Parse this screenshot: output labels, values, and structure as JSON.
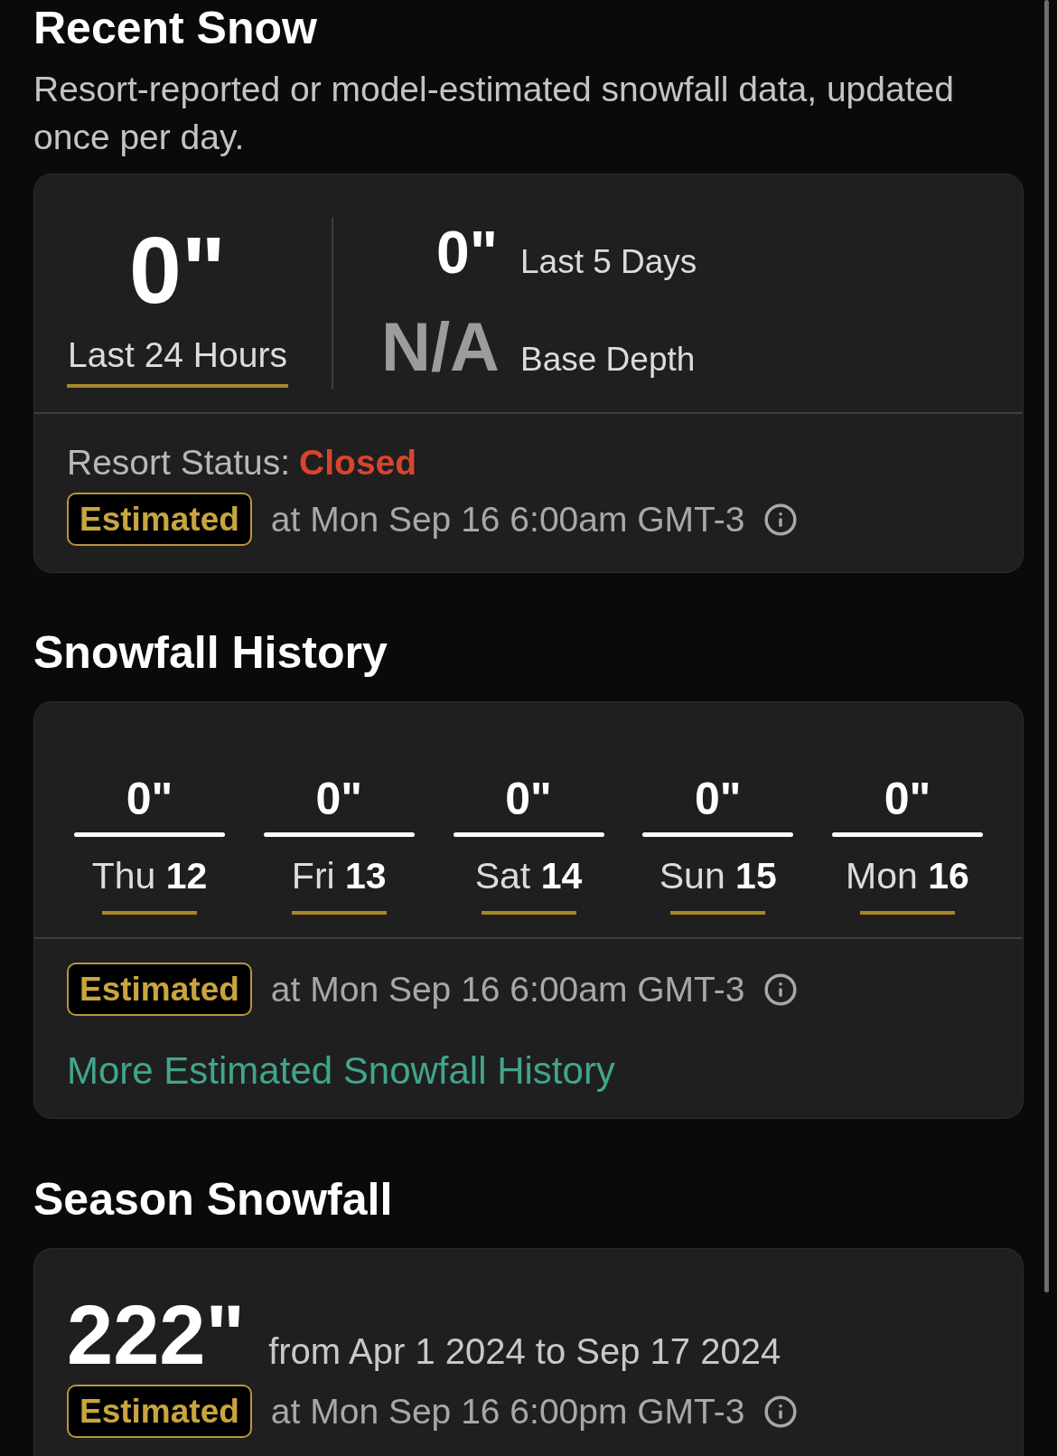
{
  "recent_snow": {
    "title": "Recent Snow",
    "subtitle": "Resort-reported or model-estimated snowfall data, updated once per day.",
    "last_24h": {
      "value": "0\"",
      "label": "Last 24 Hours"
    },
    "stats": [
      {
        "value": "0\"",
        "label": "Last 5 Days",
        "kind": "amount"
      },
      {
        "value": "N/A",
        "label": "Base Depth",
        "kind": "missing"
      }
    ],
    "status": {
      "label": "Resort Status:",
      "value": "Closed",
      "kind": "closed"
    },
    "source": {
      "badge": "Estimated",
      "timestamp": "at Mon Sep 16 6:00am GMT-3"
    }
  },
  "snowfall_history": {
    "title": "Snowfall History",
    "days": [
      {
        "amount": "0\"",
        "label": "Thu **12**"
      },
      {
        "amount": "0\"",
        "label": "Fri **13**"
      },
      {
        "amount": "0\"",
        "label": "Sat **14**"
      },
      {
        "amount": "0\"",
        "label": "Sun **15**"
      },
      {
        "amount": "0\"",
        "label": "Mon **16**"
      }
    ],
    "source": {
      "badge": "Estimated",
      "timestamp": "at Mon Sep 16 6:00am GMT-3"
    },
    "link": "More Estimated Snowfall History"
  },
  "season_snowfall": {
    "title": "Season Snowfall",
    "amount": "222\"",
    "range": "from Apr 1 2024 to Sep 17 2024",
    "source": {
      "badge": "Estimated",
      "timestamp": "at Mon Sep 16 6:00pm GMT-3"
    }
  }
}
